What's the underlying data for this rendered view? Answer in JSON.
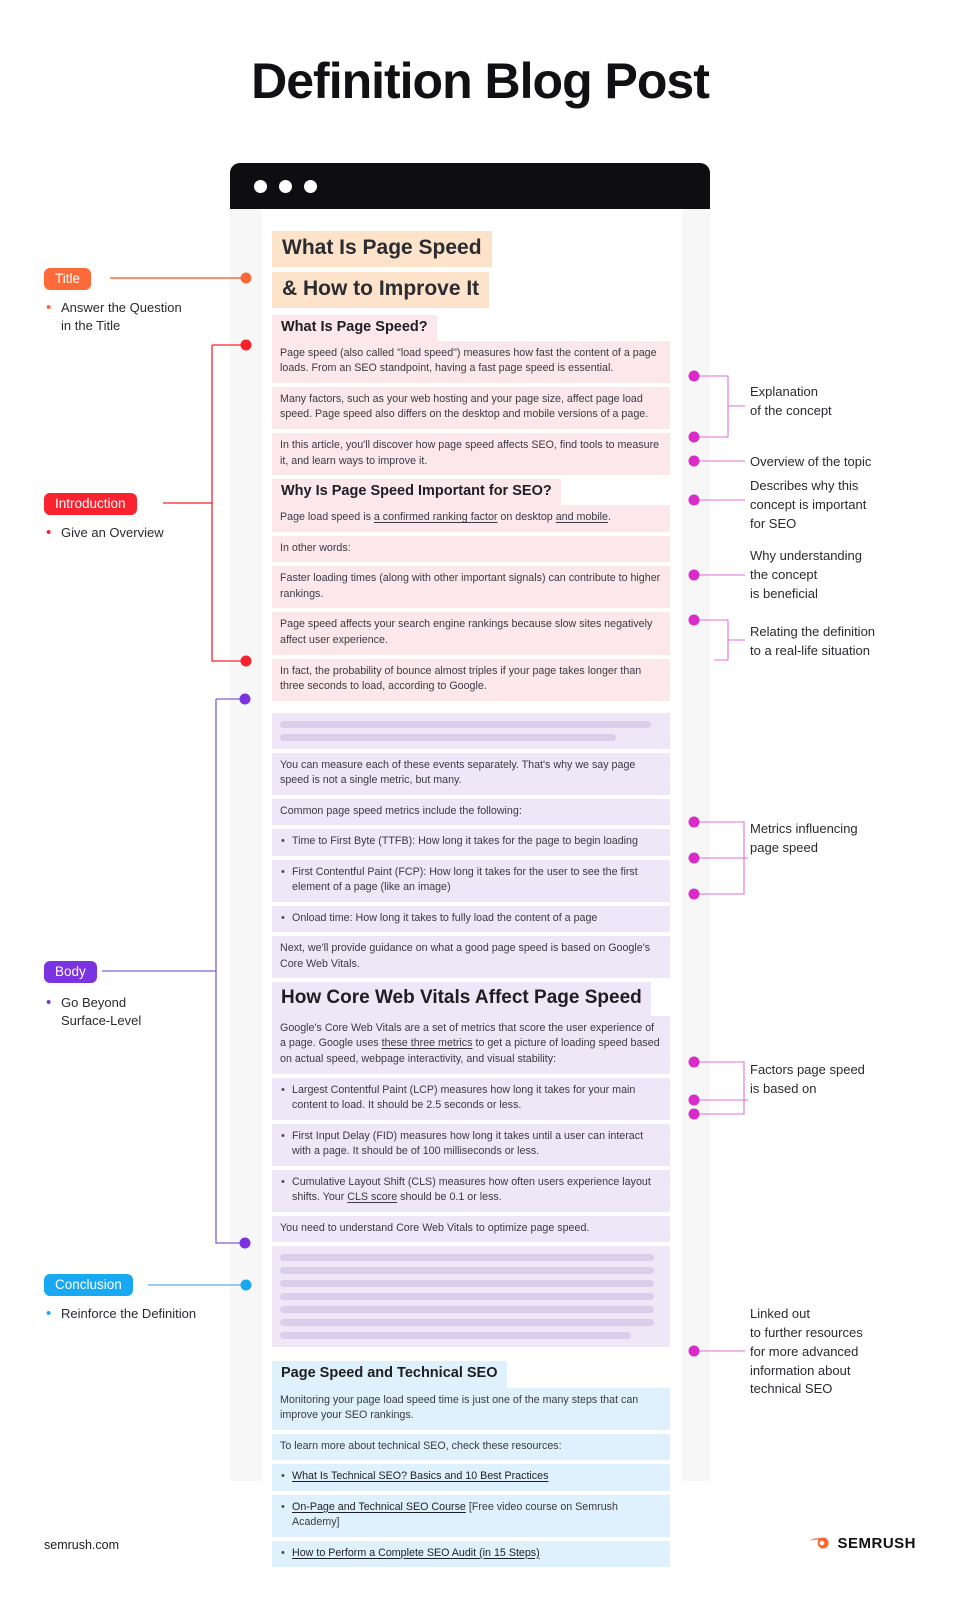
{
  "page_title": "Definition Blog Post",
  "browser": {
    "dots": 3
  },
  "article": {
    "title_line1": "What Is Page Speed",
    "title_line2": "& How to Improve It",
    "sections": {
      "intro": {
        "heading1": "What Is Page Speed?",
        "p1": "Page speed (also called \"load speed\") measures how fast the content of a page loads. From an SEO standpoint, having a fast page speed is essential.",
        "p2": "Many factors, such as your web hosting and your page size, affect page load speed. Page speed also differs on the desktop and mobile versions of a page.",
        "p3": "In this article, you'll discover how page speed affects SEO, find tools to measure it, and learn ways to improve it.",
        "heading2": "Why Is Page Speed Important for SEO?",
        "p4_a": "Page load speed is ",
        "p4_u1": "a confirmed ranking factor",
        "p4_b": " on desktop ",
        "p4_u2": "and mobile",
        "p4_c": ".",
        "p5": "In other words:",
        "p6": "Faster loading times (along with other important signals) can contribute to higher rankings.",
        "p7": "Page speed affects your search engine rankings because slow sites negatively affect user experience.",
        "p8": "In fact, the probability of bounce almost triples if your page takes longer than three seconds to load, according to Google."
      },
      "body": {
        "p1": "You can measure each of these events separately. That's why we say page speed is not a single metric, but many.",
        "p2": "Common page speed metrics include the following:",
        "li1": "Time to First Byte (TTFB): How long it takes for the page to begin loading",
        "li2": "First Contentful Paint (FCP): How long it takes for the user to see the first element of a page (like an image)",
        "li3": "Onload time: How long it takes to fully load the content of a page",
        "p3": "Next, we'll provide guidance on what a good page speed is based on Google's Core Web Vitals.",
        "heading": "How Core Web Vitals Affect Page Speed",
        "p4_a": "Google's Core Web Vitals are a set of metrics that score the user experience of a page. Google uses ",
        "p4_u": "these three metrics",
        "p4_b": " to get a picture of loading speed based on actual speed, webpage interactivity, and visual stability:",
        "li4": "Largest Contentful Paint (LCP) measures how long it takes for your main content to load. It should be 2.5 seconds or less.",
        "li5": "First Input Delay (FID) measures how long it takes until a user can interact with a page. It should be of 100 milliseconds or less.",
        "li6_a": "Cumulative Layout Shift (CLS) measures how often users experience layout shifts. Your ",
        "li6_u": "CLS score",
        "li6_b": " should be 0.1 or less.",
        "p5": "You need to understand Core Web Vitals to optimize page speed."
      },
      "conclusion": {
        "heading": "Page Speed and Technical SEO",
        "p1": "Monitoring your page load speed time is just one of the many steps that can improve your SEO rankings.",
        "p2": "To learn more about technical SEO, check these resources:",
        "link1": "What Is Technical SEO? Basics and 10 Best Practices",
        "link2_a": "On-Page and Technical SEO Course",
        "link2_b": " [Free video course on Semrush Academy]",
        "link3": "How to Perform a Complete SEO Audit (in 15 Steps)"
      }
    }
  },
  "left_labels": [
    {
      "chip": "Title",
      "sub": "Answer the Question\nin the Title",
      "color": "#fd6a3a"
    },
    {
      "chip": "Introduction",
      "sub": "Give an Overview",
      "color": "#f8232f"
    },
    {
      "chip": "Body",
      "sub": "Go Beyond\nSurface-Level",
      "color": "#7b32e0"
    },
    {
      "chip": "Conclusion",
      "sub": "Reinforce the Definition",
      "color": "#19a9f3"
    }
  ],
  "left_labels_flat": {
    "title_chip": "Title",
    "title_sub_l1": "Answer the Question",
    "title_sub_l2": "in the Title",
    "intro_chip": "Introduction",
    "intro_sub": "Give an Overview",
    "body_chip": "Body",
    "body_sub_l1": "Go Beyond",
    "body_sub_l2": "Surface-Level",
    "concl_chip": "Conclusion",
    "concl_sub": "Reinforce the Definition"
  },
  "right_notes": {
    "n1": "Explanation\nof the concept",
    "n2": "Overview of the topic",
    "n3": "Describes why this\nconcept is important\nfor SEO",
    "n4": "Why understanding\nthe concept\nis beneficial",
    "n5": "Relating the definition\nto a real-life situation",
    "n6": "Metrics influencing\npage speed",
    "n7": "Factors page speed\nis based on",
    "n8": "Linked out\nto further resources\nfor more advanced\ninformation about\ntechnical SEO"
  },
  "footer": {
    "url": "semrush.com",
    "brand": "SEMRUSH"
  },
  "colors": {
    "title_highlight": "#fde3c9",
    "intro_tint": "#fce8ec",
    "body_tint": "#eee7f8",
    "conclusion_tint": "#dff1fc",
    "orange": "#fd6a3a",
    "red": "#f8232f",
    "purple": "#7b32e0",
    "blue": "#19a9f3",
    "magenta": "#d92bc8"
  }
}
